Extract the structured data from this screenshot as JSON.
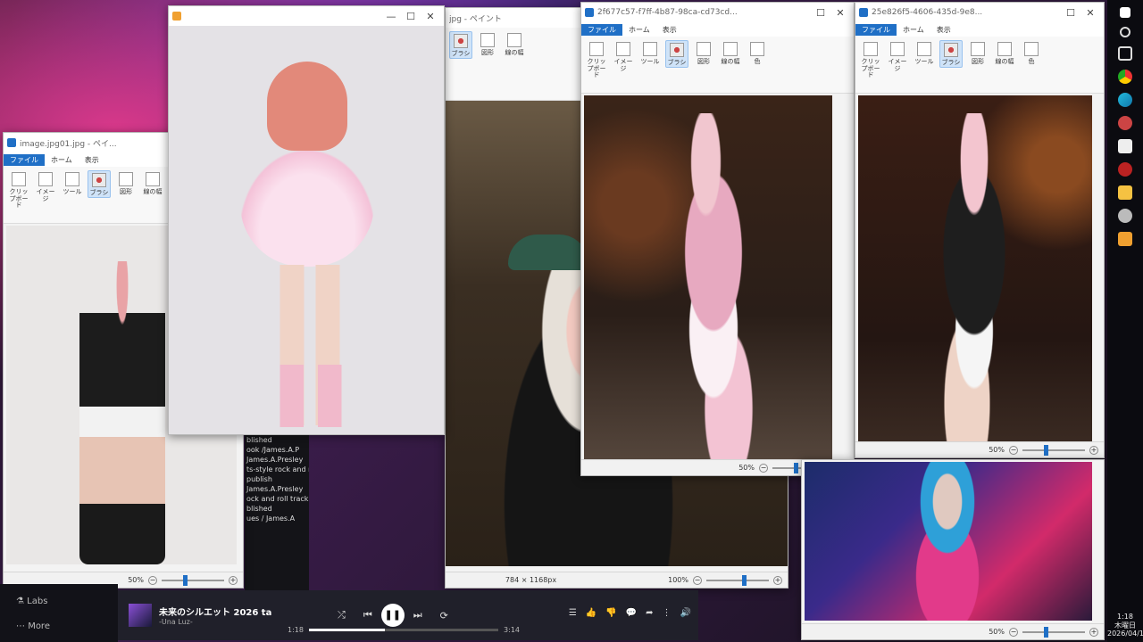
{
  "windows": {
    "w1": {
      "title": "image.jpg01.jpg - ペイ...",
      "zoom": "50%"
    },
    "w2": {
      "title": ""
    },
    "w3": {
      "title": "jpg - ペイント",
      "group_label": "図形",
      "size_info": "784 × 1168px",
      "zoom": "100%"
    },
    "w4": {
      "title": "2f677c57-f7ff-4b87-98ca-cd73cd...",
      "zoom": "50%"
    },
    "w5": {
      "title": "25e826f5-4606-435d-9e8...",
      "zoom": "50%"
    },
    "w6": {
      "zoom": "50%"
    }
  },
  "ribbon": {
    "tab_file": "ファイル",
    "tab_home": "ホーム",
    "tab_view": "表示",
    "items": [
      "クリップボード",
      "イメージ",
      "ツール",
      "ブラシ",
      "図形",
      "線の幅",
      "色"
    ]
  },
  "yt_list": [
    "blished",
    "ook /James.A.P",
    "James.A.Presley",
    "ts-style rock and roll",
    "publish",
    "James.A.Presley",
    "ock and roll track with",
    "blished",
    "ues / James.A"
  ],
  "side_nav": {
    "labs": "Labs",
    "more": "More"
  },
  "player": {
    "title": "未来のシルエット  2026 ta",
    "artist": "-Una Luz-",
    "elapsed": "1:18",
    "duration": "3:14",
    "progress": 0.4
  },
  "clock": {
    "time": "1:18",
    "day": "木曜日",
    "date": "2026/04/16"
  },
  "colors": {
    "accent": "#1f6fc6",
    "taskbar": "#0b0b10",
    "player": "#20202a"
  }
}
